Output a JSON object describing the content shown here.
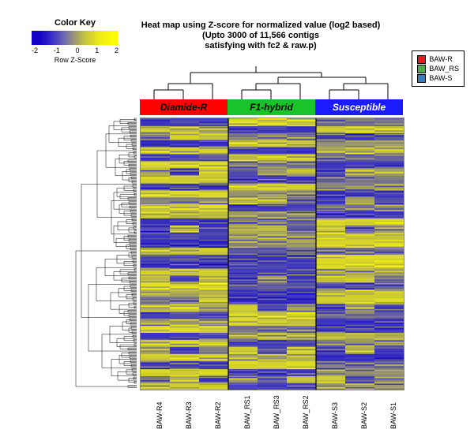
{
  "title_line1": "Heat map using Z-score for normalized value (log2 based)",
  "title_line2": "(Upto 3000 of 11,566 contigs",
  "title_line3": "satisfying with fc2 & raw.p)",
  "colorkey": {
    "title": "Color Key",
    "label": "Row Z-Score",
    "ticks": [
      "-2",
      "-1",
      "0",
      "1",
      "2"
    ]
  },
  "legend": [
    {
      "name": "BAW-R",
      "color": "#e41a1c"
    },
    {
      "name": "BAW_RS",
      "color": "#4daf4a"
    },
    {
      "name": "BAW-S",
      "color": "#377eb8"
    }
  ],
  "groups": [
    {
      "label": "Diamide-R",
      "color": "#ff0000",
      "text": "#000000"
    },
    {
      "label": "F1-hybrid",
      "color": "#19c42b",
      "text": "#000000"
    },
    {
      "label": "Susceptible",
      "color": "#1b1bff",
      "text": "#ffffff"
    }
  ],
  "columns": [
    "BAW-R4",
    "BAW-R3",
    "BAW-R2",
    "BAW_RS1",
    "BAW_RS3",
    "BAW_RS2",
    "BAW-S3",
    "BAW-S2",
    "BAW-S1"
  ],
  "chart_data": {
    "type": "heatmap",
    "title": "Heat map using Z-score for normalized value (log2 based)",
    "zscale": {
      "min": -2.5,
      "max": 2.5,
      "label": "Row Z-Score"
    },
    "column_groups": {
      "BAW-R": [
        "BAW-R4",
        "BAW-R3",
        "BAW-R2"
      ],
      "BAW_RS": [
        "BAW_RS1",
        "BAW_RS3",
        "BAW_RS2"
      ],
      "BAW-S": [
        "BAW-S3",
        "BAW-S2",
        "BAW-S1"
      ]
    },
    "column_dendrogram": "three top-level clusters: (R4,R3,R2), (RS1,RS3,RS2), (S3,S2,S1); RS and S merge before joining R",
    "note": "Approximate row-block averaged Z-scores (≈3000 contigs shown as ~38 visual bands). Each band is the dominant colour read from the figure; positive ≈ yellow, negative ≈ blue.",
    "columns": [
      "BAW-R4",
      "BAW-R3",
      "BAW-R2",
      "BAW_RS1",
      "BAW_RS3",
      "BAW_RS2",
      "BAW-S3",
      "BAW-S2",
      "BAW-S1"
    ],
    "row_bands": [
      [
        -1.2,
        -0.9,
        -1.0,
        1.3,
        1.2,
        1.1,
        -0.4,
        -0.3,
        -0.2
      ],
      [
        0.9,
        0.8,
        0.6,
        -1.1,
        -1.0,
        -1.2,
        1.0,
        1.2,
        1.1
      ],
      [
        -0.3,
        1.1,
        0.9,
        -0.2,
        0.0,
        -0.1,
        -0.9,
        -1.0,
        -0.8
      ],
      [
        -1.4,
        -1.3,
        -1.2,
        1.2,
        1.0,
        0.8,
        0.1,
        0.2,
        0.3
      ],
      [
        1.1,
        0.9,
        1.0,
        -1.0,
        -1.1,
        -1.2,
        0.6,
        0.7,
        0.8
      ],
      [
        -1.0,
        -0.8,
        -0.6,
        0.9,
        1.1,
        1.0,
        -0.4,
        -0.3,
        -0.4
      ],
      [
        1.4,
        1.3,
        1.2,
        -0.2,
        -0.1,
        -0.3,
        -1.1,
        -1.0,
        -1.2
      ],
      [
        0.2,
        -1.0,
        1.1,
        -0.7,
        0.3,
        0.8,
        -1.0,
        0.6,
        0.7
      ],
      [
        1.2,
        1.1,
        1.0,
        -1.0,
        -0.9,
        -1.1,
        -0.4,
        -0.3,
        -0.2
      ],
      [
        -1.1,
        -0.9,
        -1.2,
        1.1,
        1.2,
        1.0,
        0.0,
        0.1,
        0.2
      ],
      [
        1.3,
        1.2,
        1.4,
        0.1,
        0.2,
        0.0,
        -1.2,
        -1.1,
        -1.0
      ],
      [
        -0.1,
        -0.2,
        0.1,
        0.9,
        0.8,
        -0.6,
        -1.0,
        0.5,
        -0.8
      ],
      [
        1.2,
        1.1,
        1.3,
        -1.1,
        -1.0,
        -0.9,
        -0.2,
        -0.1,
        0.0
      ],
      [
        0.9,
        0.7,
        0.8,
        0.3,
        0.2,
        0.1,
        -1.2,
        -1.1,
        -1.0
      ],
      [
        -1.3,
        -1.1,
        -1.2,
        -0.3,
        -0.2,
        -0.4,
        1.3,
        1.2,
        1.4
      ],
      [
        -1.0,
        0.8,
        -0.9,
        0.6,
        0.7,
        -0.6,
        1.0,
        -0.7,
        0.1
      ],
      [
        -1.0,
        -0.8,
        -0.9,
        0.3,
        0.4,
        0.2,
        1.1,
        1.0,
        0.9
      ],
      [
        -1.4,
        -1.3,
        -1.5,
        0.2,
        0.1,
        0.3,
        1.3,
        1.2,
        1.4
      ],
      [
        0.9,
        0.8,
        1.0,
        -0.6,
        -0.7,
        -0.5,
        -0.4,
        -0.3,
        -0.5
      ],
      [
        -0.8,
        -0.7,
        -0.9,
        -1.0,
        -1.1,
        -0.9,
        1.3,
        1.4,
        1.5
      ],
      [
        -1.3,
        -1.2,
        -1.4,
        -0.8,
        -0.9,
        -1.0,
        1.4,
        1.3,
        1.5
      ],
      [
        1.0,
        0.9,
        1.1,
        -1.0,
        -0.9,
        -0.8,
        0.4,
        0.3,
        0.5
      ],
      [
        0.7,
        -0.9,
        0.8,
        -1.1,
        0.2,
        -1.0,
        0.9,
        1.0,
        -0.3
      ],
      [
        1.4,
        1.3,
        1.5,
        -0.6,
        -0.5,
        -0.7,
        -0.8,
        -0.9,
        -0.7
      ],
      [
        0.6,
        0.5,
        0.7,
        -1.2,
        -1.1,
        -1.3,
        0.8,
        0.9,
        1.0
      ],
      [
        -0.3,
        -0.4,
        1.0,
        -1.4,
        -1.3,
        -1.5,
        1.1,
        1.2,
        1.3
      ],
      [
        0.8,
        1.2,
        0.3,
        1.0,
        -0.8,
        0.2,
        -1.1,
        0.4,
        -0.9
      ],
      [
        -1.0,
        -0.8,
        -0.9,
        1.2,
        1.1,
        1.3,
        -0.4,
        -0.3,
        -0.5
      ],
      [
        0.4,
        0.5,
        0.3,
        1.1,
        1.0,
        0.9,
        -1.2,
        -1.3,
        -1.1
      ],
      [
        1.3,
        1.4,
        1.2,
        -0.3,
        -0.4,
        -0.2,
        -1.0,
        -0.9,
        -1.1
      ],
      [
        -1.1,
        -1.0,
        -0.8,
        0.5,
        0.7,
        0.6,
        0.8,
        0.7,
        0.6
      ],
      [
        0.9,
        1.0,
        1.1,
        -0.9,
        -1.0,
        -0.8,
        -0.1,
        0.0,
        0.1
      ],
      [
        0.4,
        -1.0,
        -0.2,
        1.1,
        -0.7,
        1.0,
        -0.9,
        0.8,
        -1.0
      ],
      [
        1.1,
        1.2,
        1.0,
        0.6,
        0.5,
        0.7,
        -1.4,
        -1.3,
        -1.5
      ],
      [
        -0.9,
        -0.8,
        -1.0,
        1.3,
        1.2,
        1.4,
        -0.3,
        -0.4,
        -0.2
      ],
      [
        1.2,
        1.1,
        1.3,
        -1.0,
        -1.1,
        -0.9,
        0.1,
        0.0,
        0.2
      ],
      [
        -0.4,
        0.8,
        -1.0,
        0.3,
        -0.6,
        0.9,
        1.1,
        -0.8,
        0.0
      ],
      [
        0.8,
        0.9,
        1.0,
        -0.9,
        -1.0,
        -0.8,
        0.3,
        0.2,
        0.1
      ]
    ]
  }
}
